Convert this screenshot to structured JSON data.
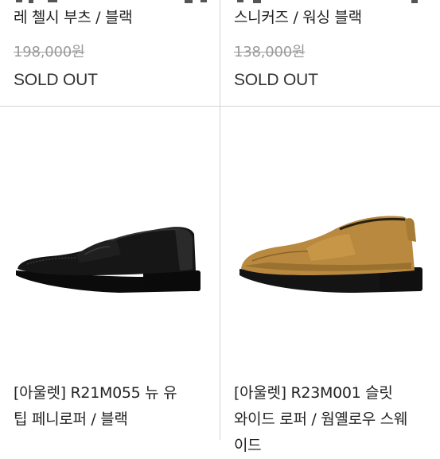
{
  "products_top": [
    {
      "title_line_partial": "",
      "title_line": "레 첼시 부츠 / 블랙",
      "original_price": "198,000원",
      "status": "SOLD OUT"
    },
    {
      "title_line_partial": "",
      "title_line": "스니커즈 / 워싱 블랙",
      "original_price": "138,000원",
      "status": "SOLD OUT"
    }
  ],
  "products_bottom": [
    {
      "title_line1": "[아울렛] R21M055 뉴 유",
      "title_line2": "팁 페니로퍼 / 블랙",
      "image_icon": "black-penny-loafer-image",
      "shoe_color": "#141414"
    },
    {
      "title_line1": "[아울렛] R23M001 슬릿",
      "title_line2": "와이드 로퍼 / 웜옐로우 스웨",
      "title_line3": "이드",
      "image_icon": "tan-suede-loafer-image",
      "shoe_color": "#b8893f"
    }
  ]
}
